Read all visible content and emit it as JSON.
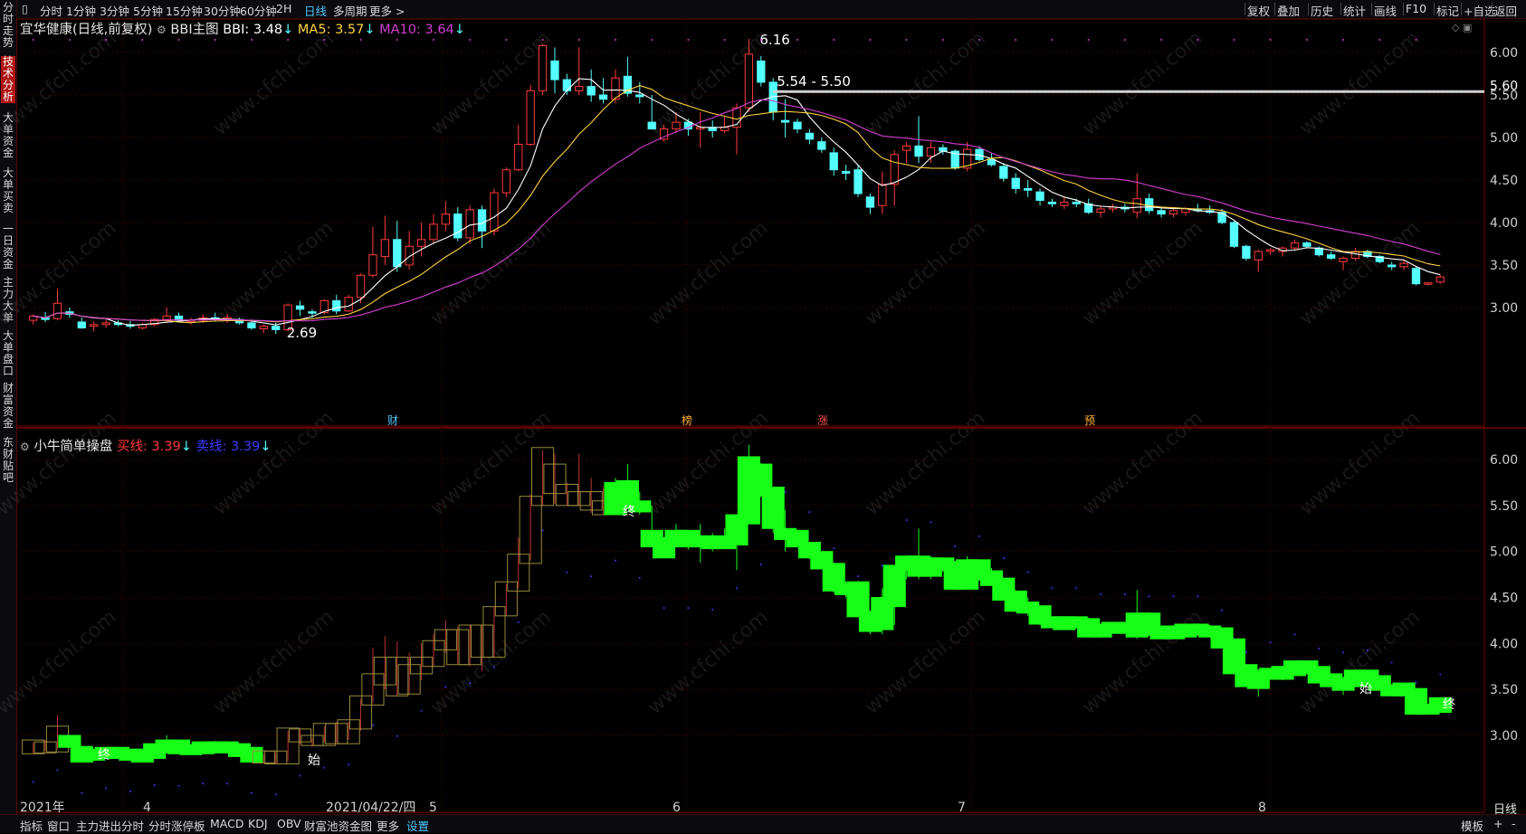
{
  "top_tabs": [
    "分时",
    "1分钟",
    "3分钟",
    "5分钟",
    "15分钟",
    "30分钟",
    "60分钟",
    "2H",
    "日线",
    "多周期",
    "更多 >"
  ],
  "top_tab_active": "日线",
  "top_right": [
    "复权",
    "叠加",
    "历史",
    "统计",
    "画线",
    "F10",
    "标记",
    "+自选",
    "返回"
  ],
  "sidebar": [
    "分时走势",
    "技术分析",
    "大单资金",
    "大单买卖",
    "一日资金",
    "主力大单",
    "大单盘口",
    "财富资金",
    "东财贴吧"
  ],
  "sidebar_active": "技术分析",
  "main_panel": {
    "title": "宜华健康(日线,前复权)",
    "indicator": "BBI主图",
    "bbi": "BBI: 3.48",
    "ma5": "MA5: 3.57",
    "ma10": "MA10: 3.64",
    "high_label": "6.16",
    "low_label": "2.69",
    "range_label": "5.54 - 5.50",
    "price_tag": "5.60",
    "y_ticks": [
      "6.00",
      "5.50",
      "5.00",
      "4.50",
      "4.00",
      "3.50",
      "3.00"
    ],
    "events": [
      "财",
      "榜",
      "涨",
      "预"
    ]
  },
  "sub_panel": {
    "title": "小牛简单操盘",
    "buy_line": "买线: 3.39",
    "sell_line": "卖线: 3.39",
    "y_ticks": [
      "6.00",
      "5.50",
      "5.00",
      "4.50",
      "4.00",
      "3.50",
      "3.00"
    ],
    "markers": [
      "终",
      "始",
      "终",
      "始",
      "终"
    ]
  },
  "x_axis": [
    "2021年",
    "4",
    "2021/04/22/四",
    "5",
    "6",
    "7",
    "8"
  ],
  "period": "日线",
  "bottom_tabs": [
    "指标",
    "窗口",
    "主力进出分时",
    "分时涨停板",
    "MACD",
    "KDJ",
    "OBV",
    "财富池资金图",
    "更多",
    "设置"
  ],
  "bottom_tab_active": "设置",
  "bottom_right": [
    "模板",
    "+",
    "-"
  ],
  "watermark": "www.cfchi.com",
  "colors": {
    "up": "#ff3b3b",
    "down": "#54ffff",
    "ma5": "#ffd23f",
    "ma10": "#d33fd3",
    "bbi": "#ffffff",
    "sub_up": "#16ff16",
    "panel_border": "#7a0000"
  },
  "chart_data": {
    "type": "candlestick",
    "title": "宜华健康(日线,前复权)",
    "ylim": [
      2.6,
      6.25
    ],
    "ohlc": [
      [
        2.85,
        2.92,
        2.8,
        2.9
      ],
      [
        2.88,
        2.95,
        2.83,
        2.86
      ],
      [
        2.87,
        3.22,
        2.85,
        3.05
      ],
      [
        2.95,
        3.0,
        2.88,
        2.92
      ],
      [
        2.83,
        2.88,
        2.75,
        2.76
      ],
      [
        2.78,
        2.84,
        2.72,
        2.8
      ],
      [
        2.8,
        2.86,
        2.76,
        2.82
      ],
      [
        2.82,
        2.85,
        2.78,
        2.8
      ],
      [
        2.8,
        2.84,
        2.75,
        2.78
      ],
      [
        2.76,
        2.82,
        2.74,
        2.8
      ],
      [
        2.8,
        2.88,
        2.78,
        2.86
      ],
      [
        2.86,
        3.0,
        2.82,
        2.9
      ],
      [
        2.9,
        2.94,
        2.84,
        2.85
      ],
      [
        2.84,
        2.88,
        2.8,
        2.85
      ],
      [
        2.85,
        2.92,
        2.82,
        2.88
      ],
      [
        2.88,
        2.94,
        2.84,
        2.86
      ],
      [
        2.86,
        2.92,
        2.82,
        2.88
      ],
      [
        2.86,
        2.88,
        2.8,
        2.82
      ],
      [
        2.82,
        2.86,
        2.74,
        2.76
      ],
      [
        2.75,
        2.8,
        2.7,
        2.78
      ],
      [
        2.78,
        2.82,
        2.69,
        2.74
      ],
      [
        2.74,
        3.05,
        2.72,
        3.03
      ],
      [
        3.02,
        3.08,
        2.9,
        2.98
      ],
      [
        2.95,
        2.98,
        2.88,
        2.94
      ],
      [
        2.94,
        3.1,
        2.92,
        3.08
      ],
      [
        3.08,
        3.15,
        2.92,
        2.96
      ],
      [
        2.96,
        3.15,
        2.95,
        3.12
      ],
      [
        3.12,
        3.4,
        3.05,
        3.38
      ],
      [
        3.38,
        3.95,
        3.35,
        3.62
      ],
      [
        3.6,
        4.08,
        3.5,
        3.8
      ],
      [
        3.8,
        4.02,
        3.42,
        3.48
      ],
      [
        3.5,
        3.9,
        3.45,
        3.72
      ],
      [
        3.72,
        4.0,
        3.6,
        3.8
      ],
      [
        3.8,
        4.1,
        3.75,
        3.98
      ],
      [
        3.98,
        4.25,
        3.9,
        4.1
      ],
      [
        4.1,
        4.18,
        3.78,
        3.82
      ],
      [
        3.82,
        4.2,
        3.75,
        4.15
      ],
      [
        4.15,
        4.2,
        3.7,
        3.9
      ],
      [
        3.9,
        4.4,
        3.85,
        4.35
      ],
      [
        4.35,
        4.65,
        4.3,
        4.62
      ],
      [
        4.62,
        5.15,
        4.6,
        4.92
      ],
      [
        4.92,
        5.62,
        4.9,
        5.55
      ],
      [
        5.55,
        6.1,
        5.5,
        6.08
      ],
      [
        5.9,
        6.06,
        5.52,
        5.68
      ],
      [
        5.68,
        5.75,
        5.5,
        5.55
      ],
      [
        5.55,
        6.06,
        5.5,
        5.6
      ],
      [
        5.6,
        5.8,
        5.42,
        5.5
      ],
      [
        5.5,
        5.7,
        5.4,
        5.45
      ],
      [
        5.45,
        5.8,
        5.4,
        5.7
      ],
      [
        5.72,
        5.95,
        5.48,
        5.52
      ],
      [
        5.5,
        5.65,
        5.4,
        5.48
      ],
      [
        5.18,
        5.5,
        5.15,
        5.1
      ],
      [
        4.98,
        5.15,
        4.95,
        5.1
      ],
      [
        5.1,
        5.3,
        5.05,
        5.18
      ],
      [
        5.18,
        5.22,
        5.02,
        5.1
      ],
      [
        5.1,
        5.3,
        4.88,
        5.12
      ],
      [
        5.12,
        5.2,
        5.0,
        5.08
      ],
      [
        5.08,
        5.25,
        5.05,
        5.12
      ],
      [
        5.12,
        5.4,
        4.8,
        5.35
      ],
      [
        5.35,
        6.16,
        5.3,
        5.98
      ],
      [
        5.9,
        5.96,
        5.6,
        5.65
      ],
      [
        5.65,
        5.7,
        5.2,
        5.3
      ],
      [
        5.2,
        5.45,
        5.0,
        5.18
      ],
      [
        5.18,
        5.22,
        5.05,
        5.1
      ],
      [
        5.05,
        5.1,
        4.92,
        4.98
      ],
      [
        4.95,
        5.0,
        4.82,
        4.86
      ],
      [
        4.82,
        4.88,
        4.55,
        4.62
      ],
      [
        4.6,
        4.68,
        4.5,
        4.58
      ],
      [
        4.62,
        4.68,
        4.3,
        4.34
      ],
      [
        4.3,
        4.34,
        4.1,
        4.18
      ],
      [
        4.2,
        4.6,
        4.1,
        4.45
      ],
      [
        4.45,
        4.85,
        4.2,
        4.8
      ],
      [
        4.85,
        4.95,
        4.7,
        4.9
      ],
      [
        4.9,
        5.25,
        4.7,
        4.78
      ],
      [
        4.78,
        4.95,
        4.7,
        4.88
      ],
      [
        4.88,
        4.92,
        4.8,
        4.84
      ],
      [
        4.84,
        4.86,
        4.62,
        4.64
      ],
      [
        4.64,
        4.95,
        4.6,
        4.86
      ],
      [
        4.86,
        4.9,
        4.72,
        4.74
      ],
      [
        4.74,
        4.82,
        4.66,
        4.68
      ],
      [
        4.66,
        4.7,
        4.48,
        4.52
      ],
      [
        4.52,
        4.58,
        4.34,
        4.4
      ],
      [
        4.4,
        4.5,
        4.3,
        4.38
      ],
      [
        4.36,
        4.4,
        4.2,
        4.26
      ],
      [
        4.24,
        4.28,
        4.18,
        4.22
      ],
      [
        4.2,
        4.3,
        4.16,
        4.24
      ],
      [
        4.24,
        4.28,
        4.18,
        4.22
      ],
      [
        4.22,
        4.28,
        4.1,
        4.12
      ],
      [
        4.12,
        4.2,
        4.06,
        4.16
      ],
      [
        4.16,
        4.22,
        4.12,
        4.18
      ],
      [
        4.18,
        4.22,
        4.12,
        4.16
      ],
      [
        4.12,
        4.58,
        4.05,
        4.28
      ],
      [
        4.28,
        4.34,
        4.1,
        4.14
      ],
      [
        4.14,
        4.18,
        4.06,
        4.1
      ],
      [
        4.1,
        4.16,
        4.06,
        4.14
      ],
      [
        4.12,
        4.18,
        4.08,
        4.16
      ],
      [
        4.16,
        4.22,
        4.12,
        4.14
      ],
      [
        4.14,
        4.2,
        4.1,
        4.12
      ],
      [
        4.12,
        4.16,
        3.98,
        4.0
      ],
      [
        4.0,
        4.02,
        3.7,
        3.72
      ],
      [
        3.72,
        3.74,
        3.55,
        3.58
      ],
      [
        3.56,
        3.68,
        3.42,
        3.66
      ],
      [
        3.66,
        3.7,
        3.62,
        3.68
      ],
      [
        3.66,
        3.72,
        3.6,
        3.7
      ],
      [
        3.7,
        3.8,
        3.68,
        3.76
      ],
      [
        3.76,
        3.78,
        3.7,
        3.72
      ],
      [
        3.7,
        3.72,
        3.6,
        3.62
      ],
      [
        3.62,
        3.66,
        3.56,
        3.58
      ],
      [
        3.54,
        3.6,
        3.44,
        3.58
      ],
      [
        3.58,
        3.7,
        3.55,
        3.66
      ],
      [
        3.66,
        3.68,
        3.58,
        3.6
      ],
      [
        3.6,
        3.62,
        3.52,
        3.54
      ],
      [
        3.5,
        3.54,
        3.44,
        3.48
      ],
      [
        3.48,
        3.56,
        3.44,
        3.52
      ],
      [
        3.46,
        3.48,
        3.26,
        3.28
      ],
      [
        3.28,
        3.3,
        3.26,
        3.29
      ],
      [
        3.3,
        3.38,
        3.28,
        3.36
      ]
    ]
  }
}
